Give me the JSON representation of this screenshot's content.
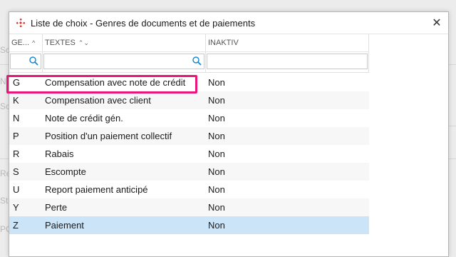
{
  "dialog": {
    "title": "Liste de choix - Genres de documents et de paiements",
    "close_symbol": "✕"
  },
  "columns": [
    {
      "label": "GE...",
      "sort_icon": "^"
    },
    {
      "label": "TEXTES",
      "sort_icon": "⌃⌄"
    },
    {
      "label": "INAKTIV"
    }
  ],
  "rows": [
    {
      "code": "G",
      "text": "Compensation avec note de crédit",
      "inaktiv": "Non"
    },
    {
      "code": "K",
      "text": "Compensation avec client",
      "inaktiv": "Non"
    },
    {
      "code": "N",
      "text": "Note de crédit gén.",
      "inaktiv": "Non"
    },
    {
      "code": "P",
      "text": "Position d'un paiement collectif",
      "inaktiv": "Non"
    },
    {
      "code": "R",
      "text": "Rabais",
      "inaktiv": "Non"
    },
    {
      "code": "S",
      "text": "Escompte",
      "inaktiv": "Non"
    },
    {
      "code": "U",
      "text": "Report paiement anticipé",
      "inaktiv": "Non"
    },
    {
      "code": "Y",
      "text": "Perte",
      "inaktiv": "Non"
    },
    {
      "code": "Z",
      "text": "Paiement",
      "inaktiv": "Non"
    }
  ],
  "background": {
    "fragments": [
      "Sc",
      "N",
      "Sc",
      "Re",
      "St",
      "PC"
    ]
  },
  "colors": {
    "highlight": "#e8157a",
    "selected_row": "#cce4f7",
    "title_icon": "#d9302a"
  }
}
